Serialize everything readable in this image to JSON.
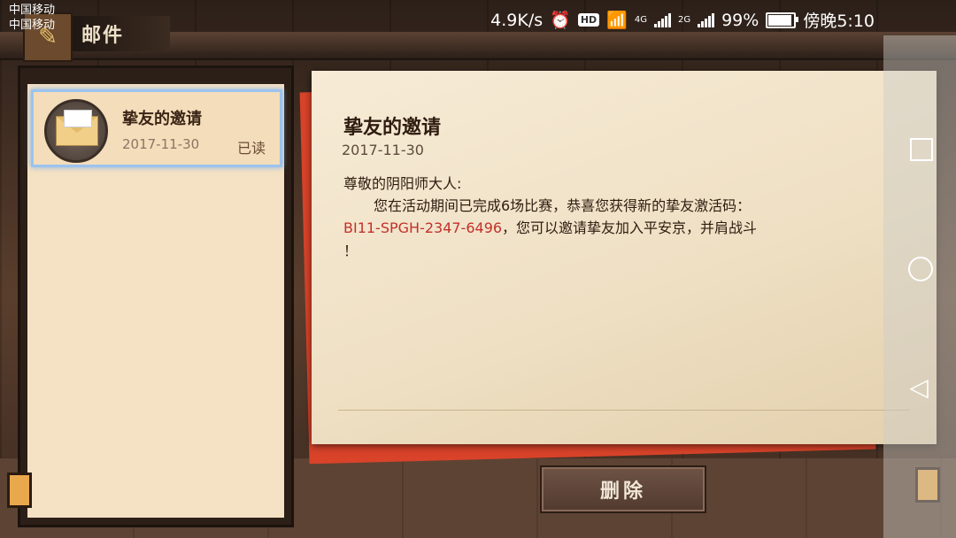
{
  "status_bar": {
    "carrier1": "中国移动",
    "carrier2": "中国移动",
    "speed": "4.9K/s",
    "hd": "HD",
    "net1": "4G",
    "net2": "2G",
    "battery": "99%",
    "battery_level": 0.99,
    "time": "傍晚5:10"
  },
  "header": {
    "title": "邮件",
    "icon": "brush-icon"
  },
  "mail_list": [
    {
      "title": "挚友的邀请",
      "date": "2017-11-30",
      "status": "已读",
      "icon": "envelope-icon"
    }
  ],
  "letter": {
    "title": "挚友的邀请",
    "date": "2017-11-30",
    "greeting": "尊敬的阴阳师大人:",
    "line1": "您在活动期间已完成6场比赛，恭喜您获得新的挚友激活码：",
    "code": "BI11-SPGH-2347-6496",
    "line2_rest": "，您可以邀请挚友加入平安京，并肩战斗",
    "line3": "！"
  },
  "actions": {
    "delete_label": "删除"
  },
  "nav_bar": {
    "icons": [
      "recents-square-icon",
      "home-circle-icon",
      "back-triangle-icon"
    ]
  },
  "colors": {
    "code_red": "#c2302a",
    "selected_border": "#9cc3ef",
    "paper": "#f7ebd6"
  }
}
